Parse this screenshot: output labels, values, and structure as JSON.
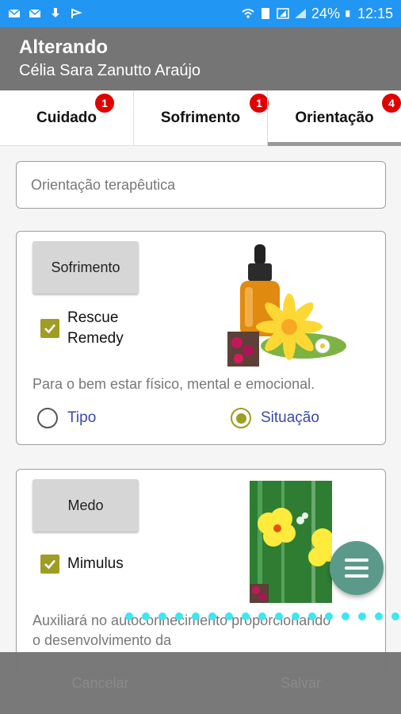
{
  "status_bar": {
    "battery": "24%",
    "time": "12:15",
    "color": "#2196f3"
  },
  "appbar": {
    "title": "Alterando",
    "subtitle": "Célia Sara Zanutto Araújo"
  },
  "tabs": [
    {
      "label": "Cuidado",
      "badge": "1"
    },
    {
      "label": "Sofrimento",
      "badge": "1"
    },
    {
      "label": "Orientação",
      "badge": "4",
      "active": true
    }
  ],
  "orientation_field": {
    "placeholder": "Orientação terapêutica",
    "value": ""
  },
  "cards": [
    {
      "button_label": "Sofrimento",
      "check_label": "Rescue Remedy",
      "checked": true,
      "image_icon": "dropper-bottle-flower-image",
      "description": "Para o bem estar físico, mental e emocional.",
      "radio_options": [
        {
          "label": "Tipo",
          "selected": false
        },
        {
          "label": "Situação",
          "selected": true
        }
      ]
    },
    {
      "button_label": "Medo",
      "check_label": "Mimulus",
      "checked": true,
      "image_icon": "yellow-flower-image",
      "description": "Auxiliará no autoconhecimento proporcionando o desenvolvimento da"
    }
  ],
  "fab": {
    "icon": "menu-icon"
  },
  "bottom_bar": {
    "cancel_label": "Cancelar",
    "save_label": "Salvar"
  },
  "colors": {
    "accent_olive": "#9e9d24",
    "badge_red": "#e00000",
    "fab_teal": "#5b9a8b",
    "link_blue": "#3949ab"
  }
}
